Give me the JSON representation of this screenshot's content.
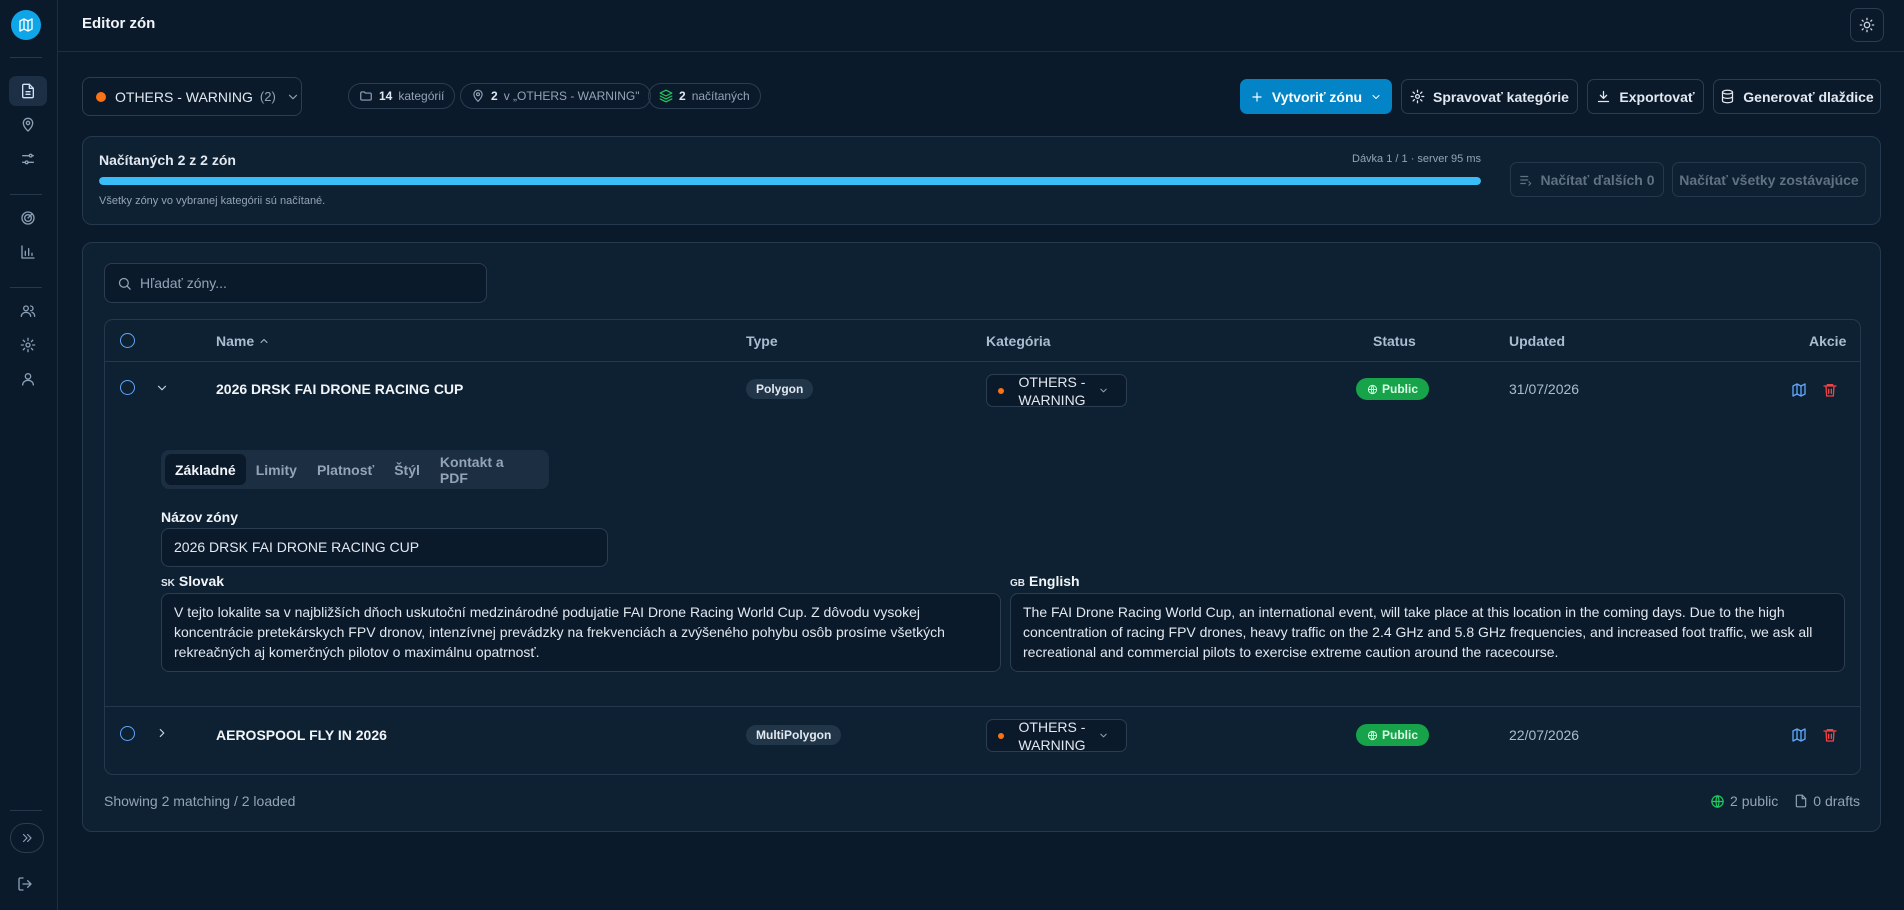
{
  "header": {
    "title": "Editor zón"
  },
  "toolbar": {
    "category": {
      "label": "OTHERS - WARNING",
      "count": "(2)"
    },
    "pills": {
      "categories": {
        "value": "14",
        "label": "kategórií"
      },
      "zones": {
        "value": "2",
        "label": "v „OTHERS - WARNING\""
      },
      "loaded": {
        "value": "2",
        "label": "načítaných"
      }
    },
    "create": "Vytvoriť zónu",
    "manage": "Spravovať kategórie",
    "export": "Exportovať",
    "tiles": "Generovať dlaždice"
  },
  "loading": {
    "title": "Načítaných 2 z 2 zón",
    "meta": "Dávka 1 / 1 · server 95 ms",
    "progress": 1.0,
    "description": "Všetky zóny vo vybranej kategórii sú načítané.",
    "load_more": "Načítať ďalších 0",
    "load_all": "Načítať všetky zostávajúce"
  },
  "search": {
    "placeholder": "Hľadať zóny..."
  },
  "table": {
    "columns": {
      "name": "Name",
      "type": "Type",
      "category": "Kategória",
      "status": "Status",
      "updated": "Updated",
      "actions": "Akcie"
    },
    "rows": [
      {
        "name": "2026 DRSK FAI DRONE RACING CUP",
        "type": "Polygon",
        "category": "OTHERS - WARNING",
        "status": "Public",
        "updated": "31/07/2026"
      },
      {
        "name": "AEROSPOOL FLY IN 2026",
        "type": "MultiPolygon",
        "category": "OTHERS - WARNING",
        "status": "Public",
        "updated": "22/07/2026"
      }
    ]
  },
  "detail": {
    "tabs": [
      "Základné",
      "Limity",
      "Platnosť",
      "Štýl",
      "Kontakt a PDF"
    ],
    "zone_name_label": "Názov zóny",
    "zone_name_value": "2026 DRSK FAI DRONE RACING CUP",
    "sk": {
      "flag": "SK",
      "label": "Slovak",
      "text": "V tejto lokalite sa v najbližších dňoch uskutoční medzinárodné podujatie FAI Drone Racing World Cup. Z dôvodu vysokej koncentrácie pretekárskych FPV dronov, intenzívnej prevádzky na frekvenciách a zvýšeného pohybu osôb prosíme všetkých rekreačných aj komerčných pilotov o maximálnu opatrnosť."
    },
    "en": {
      "flag": "GB",
      "label": "English",
      "text": "The FAI Drone Racing World Cup, an international event, will take place at this location in the coming days. Due to the high concentration of racing FPV drones, heavy traffic on the 2.4 GHz and 5.8 GHz frequencies, and increased foot traffic, we ask all recreational and commercial pilots to exercise extreme caution around the racecourse."
    }
  },
  "footer": {
    "summary": "Showing 2 matching / 2 loaded",
    "public": "2 public",
    "drafts": "0 drafts"
  },
  "colors": {
    "accent": "#0284c7",
    "public": "#16a34a",
    "warning": "#f97316",
    "delete": "#ef4444"
  }
}
